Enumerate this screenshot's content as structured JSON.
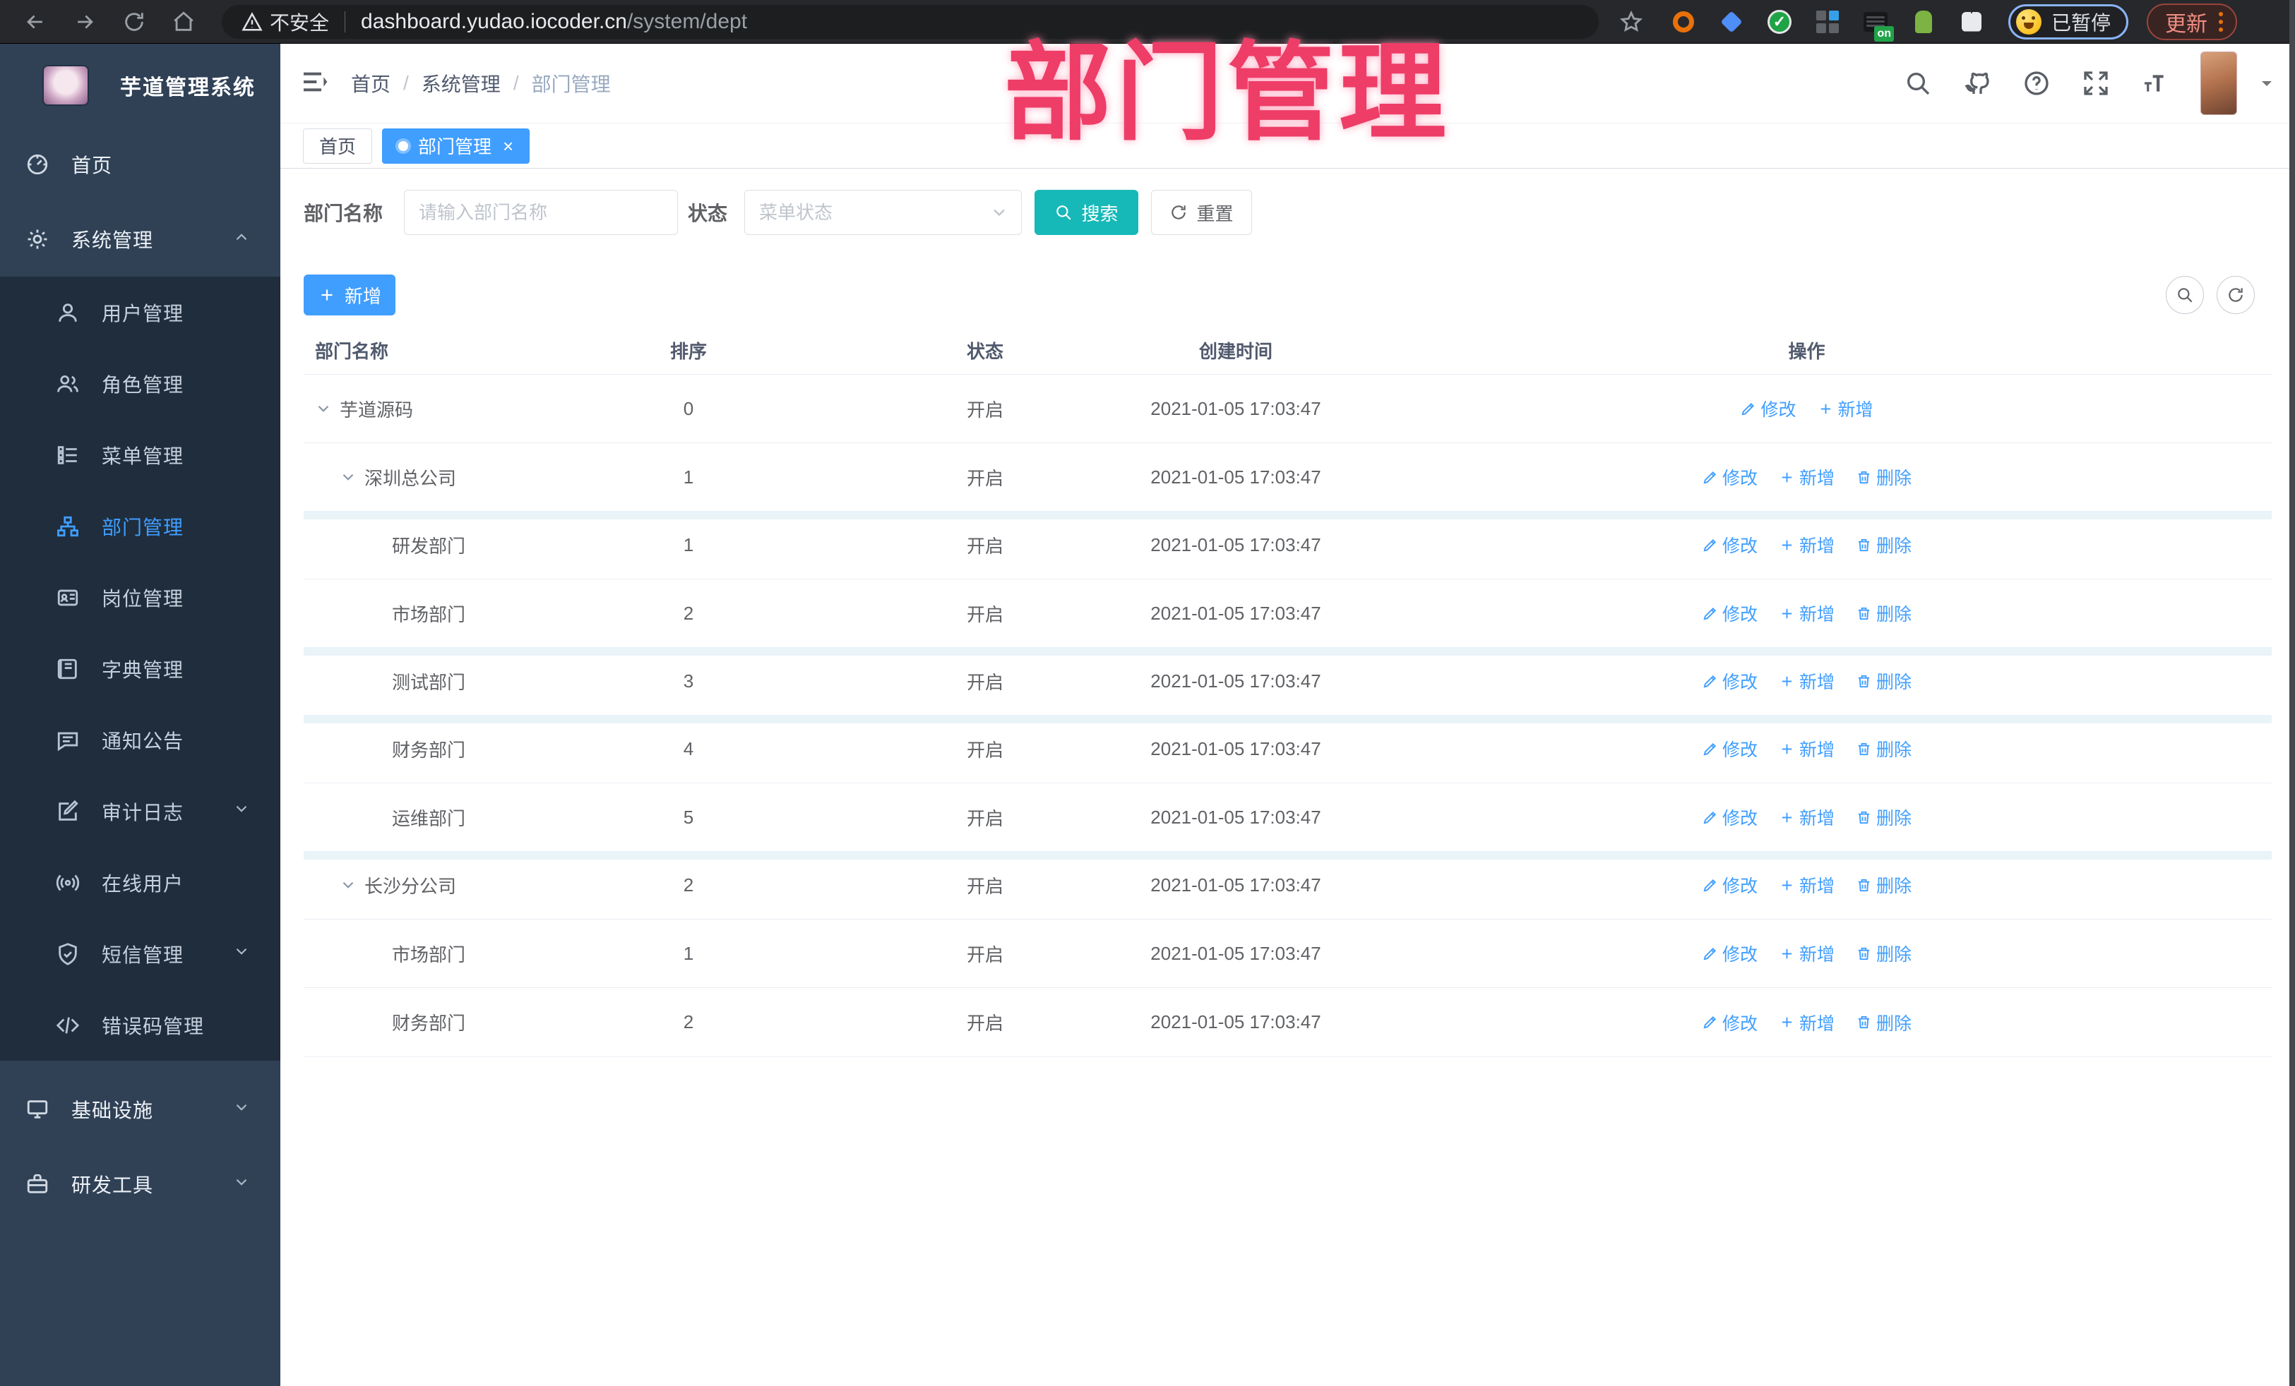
{
  "browser": {
    "security_label": "不安全",
    "url_host": "dashboard.yudao.iocoder.cn",
    "url_path": "/system/dept",
    "ext_on_label": "on",
    "profile_label": "已暂停",
    "update_label": "更新"
  },
  "overlay_title": "部门管理",
  "sidebar": {
    "logo_title": "芋道管理系统",
    "items": [
      {
        "id": "home",
        "label": "首页",
        "icon": "dashboard-icon",
        "level": 0
      },
      {
        "id": "system",
        "label": "系统管理",
        "icon": "gear-icon",
        "level": 0,
        "chevron": "up"
      },
      {
        "id": "user",
        "label": "用户管理",
        "icon": "user-icon",
        "level": 1
      },
      {
        "id": "role",
        "label": "角色管理",
        "icon": "role-icon",
        "level": 1
      },
      {
        "id": "menu",
        "label": "菜单管理",
        "icon": "menu-icon",
        "level": 1
      },
      {
        "id": "dept",
        "label": "部门管理",
        "icon": "dept-icon",
        "level": 1,
        "active": true
      },
      {
        "id": "post",
        "label": "岗位管理",
        "icon": "post-icon",
        "level": 1
      },
      {
        "id": "dict",
        "label": "字典管理",
        "icon": "dict-icon",
        "level": 1
      },
      {
        "id": "notice",
        "label": "通知公告",
        "icon": "notice-icon",
        "level": 1
      },
      {
        "id": "audit",
        "label": "审计日志",
        "icon": "audit-icon",
        "level": 1,
        "chevron": "down"
      },
      {
        "id": "online",
        "label": "在线用户",
        "icon": "online-icon",
        "level": 1
      },
      {
        "id": "sms",
        "label": "短信管理",
        "icon": "sms-icon",
        "level": 1,
        "chevron": "down"
      },
      {
        "id": "errcode",
        "label": "错误码管理",
        "icon": "code-icon",
        "level": 1
      },
      {
        "id": "infra",
        "label": "基础设施",
        "icon": "infra-icon",
        "level": 0,
        "chevron": "down",
        "gap_before": true
      },
      {
        "id": "devtool",
        "label": "研发工具",
        "icon": "tool-icon",
        "level": 0,
        "chevron": "down"
      }
    ]
  },
  "header": {
    "breadcrumb": [
      "首页",
      "系统管理",
      "部门管理"
    ]
  },
  "tabs": [
    {
      "label": "首页",
      "active": false
    },
    {
      "label": "部门管理",
      "active": true,
      "closable": true
    }
  ],
  "filter": {
    "name_label": "部门名称",
    "name_placeholder": "请输入部门名称",
    "status_label": "状态",
    "status_placeholder": "菜单状态",
    "search_label": "搜索",
    "reset_label": "重置"
  },
  "toolbar": {
    "add_label": "新增"
  },
  "table": {
    "headers": [
      "部门名称",
      "排序",
      "状态",
      "创建时间",
      "操作"
    ],
    "action_labels": {
      "edit": "修改",
      "add": "新增",
      "delete": "删除"
    },
    "rows": [
      {
        "name": "芋道源码",
        "level": 0,
        "expanded": true,
        "sort": "0",
        "status": "开启",
        "created": "2021-01-05 17:03:47",
        "actions": [
          "edit",
          "add"
        ]
      },
      {
        "name": "深圳总公司",
        "level": 1,
        "expanded": true,
        "sort": "1",
        "status": "开启",
        "created": "2021-01-05 17:03:47",
        "actions": [
          "edit",
          "add",
          "delete"
        ]
      },
      {
        "name": "研发部门",
        "level": 2,
        "expanded": false,
        "sort": "1",
        "status": "开启",
        "created": "2021-01-05 17:03:47",
        "actions": [
          "edit",
          "add",
          "delete"
        ],
        "band": true
      },
      {
        "name": "市场部门",
        "level": 2,
        "expanded": false,
        "sort": "2",
        "status": "开启",
        "created": "2021-01-05 17:03:47",
        "actions": [
          "edit",
          "add",
          "delete"
        ]
      },
      {
        "name": "测试部门",
        "level": 2,
        "expanded": false,
        "sort": "3",
        "status": "开启",
        "created": "2021-01-05 17:03:47",
        "actions": [
          "edit",
          "add",
          "delete"
        ],
        "band": true
      },
      {
        "name": "财务部门",
        "level": 2,
        "expanded": false,
        "sort": "4",
        "status": "开启",
        "created": "2021-01-05 17:03:47",
        "actions": [
          "edit",
          "add",
          "delete"
        ],
        "band": true
      },
      {
        "name": "运维部门",
        "level": 2,
        "expanded": false,
        "sort": "5",
        "status": "开启",
        "created": "2021-01-05 17:03:47",
        "actions": [
          "edit",
          "add",
          "delete"
        ]
      },
      {
        "name": "长沙分公司",
        "level": 1,
        "expanded": true,
        "sort": "2",
        "status": "开启",
        "created": "2021-01-05 17:03:47",
        "actions": [
          "edit",
          "add",
          "delete"
        ],
        "band": true
      },
      {
        "name": "市场部门",
        "level": 2,
        "expanded": false,
        "sort": "1",
        "status": "开启",
        "created": "2021-01-05 17:03:47",
        "actions": [
          "edit",
          "add",
          "delete"
        ]
      },
      {
        "name": "财务部门",
        "level": 2,
        "expanded": false,
        "sort": "2",
        "status": "开启",
        "created": "2021-01-05 17:03:47",
        "actions": [
          "edit",
          "add",
          "delete"
        ]
      }
    ]
  },
  "colors": {
    "accent": "#409EFF",
    "search_button": "#17B8B8",
    "overlay_pink": "#EE3D67",
    "sidebar_bg": "#304156",
    "submenu_bg": "#1F2D3D"
  }
}
